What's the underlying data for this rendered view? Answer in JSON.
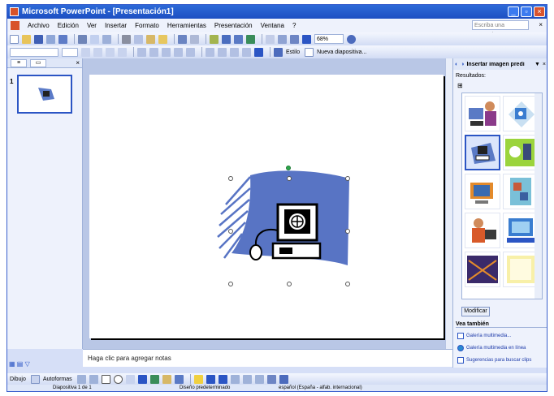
{
  "window": {
    "title": "Microsoft PowerPoint - [Presentación1]"
  },
  "menu": [
    "Archivo",
    "Edición",
    "Ver",
    "Insertar",
    "Formato",
    "Herramientas",
    "Presentación",
    "Ventana",
    "?"
  ],
  "help_box": {
    "placeholder": "Escriba una pregunta"
  },
  "toolbar": {
    "zoom": "68%",
    "design_label": "Estilo",
    "new_slide_label": "Nueva diapositiva..."
  },
  "slide_panel": {
    "slide_number": "1"
  },
  "notes": {
    "placeholder": "Haga clic para agregar notas"
  },
  "task_pane": {
    "title": "Insertar imagen predi",
    "results_label": "Resultados:",
    "modify_button": "Modificar",
    "see_also": "Vea también",
    "links": [
      "Galería multimedia...",
      "Galería multimedia en línea",
      "Sugerencias para buscar clips"
    ]
  },
  "drawing_toolbar": {
    "draw_label": "Dibujo",
    "autoshapes_label": "Autoformas"
  },
  "status": {
    "slide": "Diapositiva 1 de 1",
    "design": "Diseño predeterminado",
    "language": "español (España - alfab. internacional)"
  },
  "colors": {
    "accent": "#2b55c4",
    "titlebar": "#1d4fc2",
    "background": "#d6dff7"
  }
}
